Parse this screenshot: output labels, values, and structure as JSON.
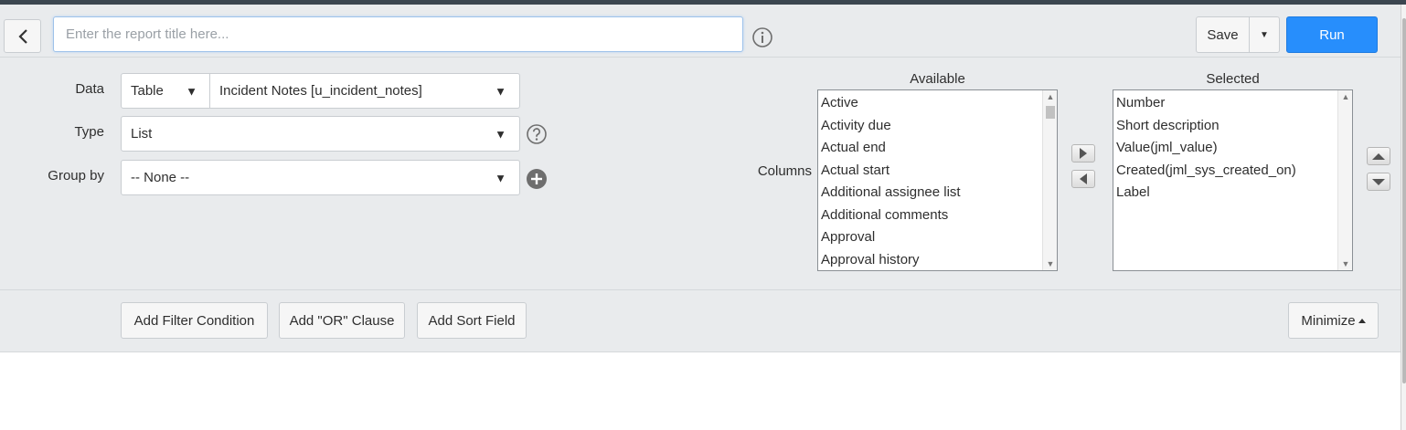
{
  "header": {
    "title_placeholder": "Enter the report title here...",
    "save_label": "Save",
    "save_dropdown_caret": "▼",
    "run_label": "Run"
  },
  "form": {
    "data": {
      "label": "Data",
      "source_type": "Table",
      "table_value": "Incident Notes [u_incident_notes]"
    },
    "type": {
      "label": "Type",
      "value": "List"
    },
    "group_by": {
      "label": "Group by",
      "value": "-- None --"
    }
  },
  "columns": {
    "label": "Columns",
    "available": {
      "header": "Available",
      "items": [
        "Active",
        "Activity due",
        "Actual end",
        "Actual start",
        "Additional assignee list",
        "Additional comments",
        "Approval",
        "Approval history"
      ]
    },
    "selected": {
      "header": "Selected",
      "items": [
        "Number",
        "Short description",
        "Value(jml_value)",
        "Created(jml_sys_created_on)",
        "Label"
      ]
    }
  },
  "filter_bar": {
    "add_filter_label": "Add Filter Condition",
    "add_or_label": "Add \"OR\" Clause",
    "add_sort_label": "Add Sort Field",
    "minimize_label": "Minimize"
  },
  "icons": {
    "back": "chevron-left-icon",
    "info": "info-icon",
    "help": "help-icon",
    "add_group": "plus-circle-icon"
  },
  "colors": {
    "primary": "#278efc",
    "panel_bg": "#e9ebed",
    "icon_gray": "#6e6e6e"
  }
}
